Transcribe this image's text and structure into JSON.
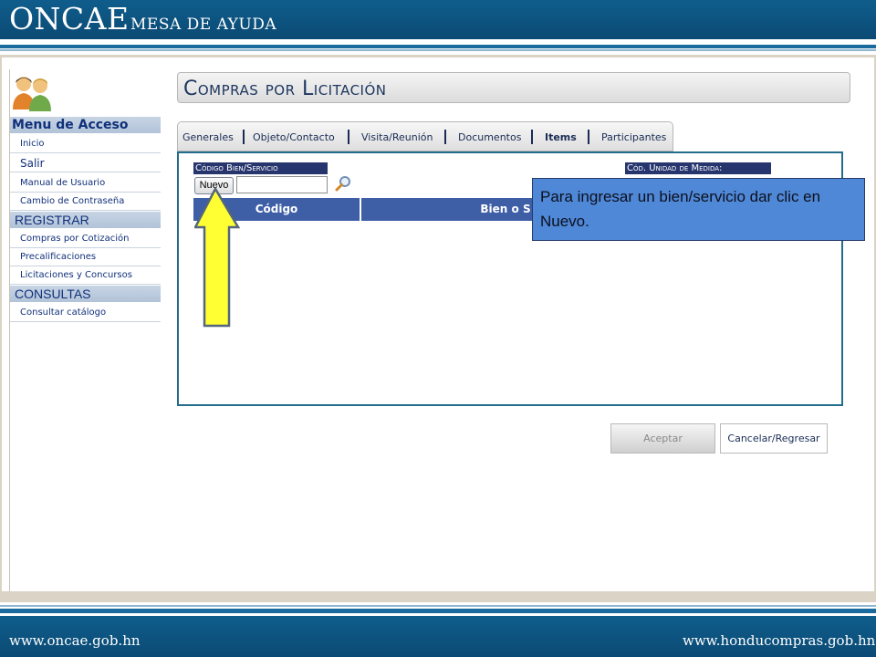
{
  "banner": {
    "brand": "ONCAE",
    "subtitle": "MESA DE AYUDA"
  },
  "sidebar": {
    "menu_title": "Menu de Acceso",
    "items": [
      {
        "label": "Inicio"
      },
      {
        "label": "Salir"
      },
      {
        "label": "Manual de Usuario"
      },
      {
        "label": "Cambio de Contraseña"
      }
    ],
    "registrar": {
      "title": "REGISTRAR",
      "items": [
        {
          "label": "Compras por Cotización"
        },
        {
          "label": "Precalificaciones"
        },
        {
          "label": "Licitaciones y Concursos"
        }
      ]
    },
    "consultas": {
      "title": "CONSULTAS",
      "items": [
        {
          "label": "Consultar catálogo"
        }
      ]
    }
  },
  "main": {
    "title": "Compras por Licitación",
    "tabs": [
      {
        "label": "Generales"
      },
      {
        "label": "Objeto/Contacto"
      },
      {
        "label": "Visita/Reunión"
      },
      {
        "label": "Documentos"
      },
      {
        "label": "Items"
      },
      {
        "label": "Participantes"
      }
    ],
    "active_tab": "Items",
    "fields": {
      "codigo_label": "Código Bien/Servicio",
      "unidad_label": "Cód. Unidad de Medida:",
      "new_button": "Nuevo",
      "code_value": ""
    },
    "table": {
      "headers": [
        "Código",
        "Bien o S"
      ]
    },
    "buttons": {
      "accept": "Aceptar",
      "cancel": "Cancelar/Regresar"
    }
  },
  "callout": {
    "text": "Para ingresar un bien/servicio dar clic en Nuevo."
  },
  "footer": {
    "left": "www.oncae.gob.hn",
    "right": "www.honducompras.gob.hn"
  },
  "colors": {
    "brand_blue": "#0f5d8c",
    "nav_text": "#10307a",
    "table_header": "#3e5ea6",
    "callout_bg": "#4f88d6",
    "arrow_fill": "#ffff33"
  }
}
